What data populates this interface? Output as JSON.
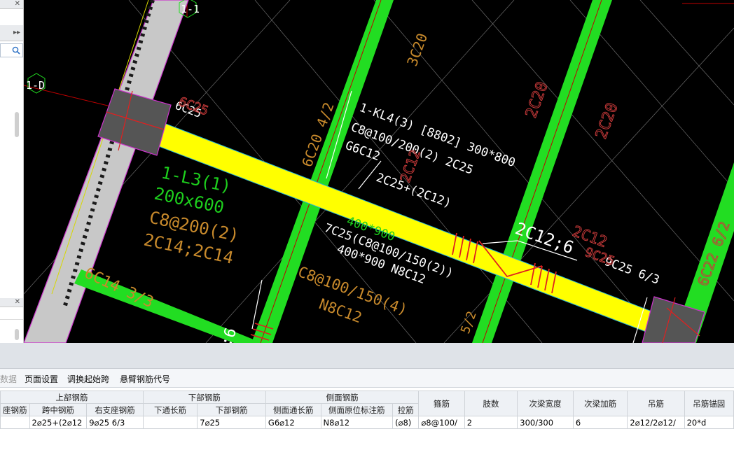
{
  "cad": {
    "axis_labels": {
      "top": "1-1",
      "left": "1-D"
    },
    "beam_span_top": "6C25",
    "span_label_main": "1-KL4(3) [8802] 300*800",
    "stirrup_main": "C8@100/200(2) 2C25",
    "side_main": "G6C12",
    "mid_top": "2C25+(2C12)",
    "mid_bottom_a": "7C25(C8@100/150(2))",
    "mid_bottom_b": "400*900 N8C12",
    "right_top_big": "2C12;6",
    "right_bottom": "9C25 6/3",
    "green_beam_left": {
      "name": "1-L3(1)",
      "size": "200x600",
      "stirrup": "C8@200(2)",
      "bars": "2C14;2C14"
    },
    "orange_left_bottom": "6C14 3/3",
    "orange_mid_a": "C8@100/150(4)",
    "orange_mid_b": "N8C12",
    "orange_mid_c": "400*900",
    "orange_rot_a": "6C20 4/2",
    "orange_rot_b": "3C20",
    "red_rot_a": "2C20",
    "red_rot_b": "2C20",
    "red_rot_c": "2C12",
    "red_rot_d": "2C12",
    "red_rot_e": "6C25",
    "red_rot_f": "9C25",
    "red_rot_g": "6C22 6/2",
    "frag_bottom_left": ";6",
    "frag_bottom_mid": "5/2"
  },
  "toolbar": {
    "items": [
      {
        "label": "数据",
        "disabled": true
      },
      {
        "label": "页面设置"
      },
      {
        "label": "调换起始跨"
      },
      {
        "label": "悬臂钢筋代号"
      }
    ]
  },
  "grid": {
    "groups": [
      "上部钢筋",
      "下部钢筋",
      "侧面钢筋"
    ],
    "headers": [
      "座钢筋",
      "跨中钢筋",
      "右支座钢筋",
      "下通长筋",
      "下部钢筋",
      "侧面通长筋",
      "侧面原位标注筋",
      "拉筋",
      "箍筋",
      "肢数",
      "次梁宽度",
      "次梁加筋",
      "吊筋",
      "吊筋锚固"
    ],
    "row": [
      "",
      "2⌀25+(2⌀12",
      "9⌀25 6/3",
      "",
      "7⌀25",
      "G6⌀12",
      "N8⌀12",
      "(⌀8)",
      "⌀8@100/",
      "2",
      "300/300",
      "6",
      "2⌀12/2⌀12/",
      "20*d"
    ]
  },
  "colors": {
    "canvas_bg": "#000000",
    "beam_yellow": "#ffff00",
    "beam_green": "#22dd22",
    "column_gray": "#555555",
    "rebar_red": "#e02020",
    "text_orange": "#c88a2c"
  }
}
